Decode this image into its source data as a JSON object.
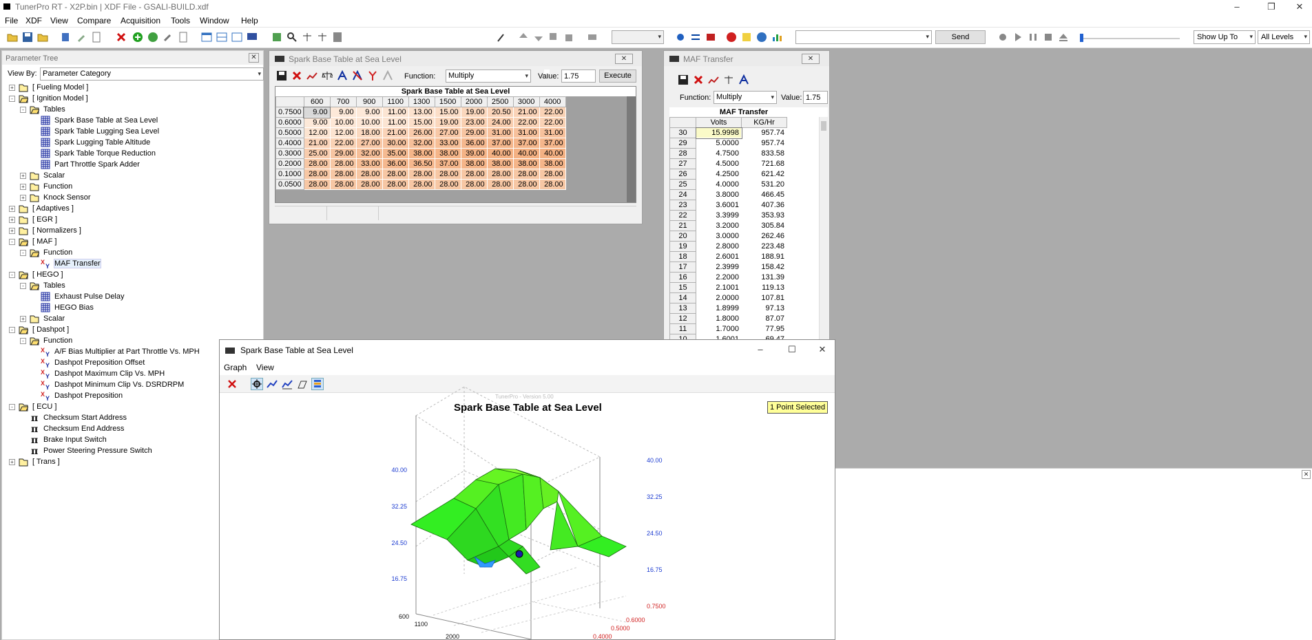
{
  "app": {
    "title": "TunerPro RT - X2P.bin | XDF File - GSALI-BUILD.xdf"
  },
  "menu": [
    "File",
    "XDF",
    "View",
    "Compare",
    "Acquisition",
    "Tools",
    "Window",
    "Help"
  ],
  "toolbar": {
    "send_label": "Send",
    "show_up_to": "Show Up To",
    "levels": "All Levels"
  },
  "tree": {
    "title": "Parameter Tree",
    "view_by_label": "View By:",
    "view_by_value": "Parameter Category",
    "nodes": [
      {
        "label": "[ Fueling Model ]",
        "level": 0,
        "icon": "folder",
        "exp": "+"
      },
      {
        "label": "[ Ignition Model ]",
        "level": 0,
        "icon": "folder-open",
        "exp": "-"
      },
      {
        "label": "Tables",
        "level": 1,
        "icon": "folder-open",
        "exp": "-"
      },
      {
        "label": "Spark Base Table at Sea Level",
        "level": 2,
        "icon": "table"
      },
      {
        "label": "Spark Table Lugging Sea Level",
        "level": 2,
        "icon": "table"
      },
      {
        "label": "Spark Lugging Table Altitude",
        "level": 2,
        "icon": "table"
      },
      {
        "label": "Spark Table Torque Reduction",
        "level": 2,
        "icon": "table"
      },
      {
        "label": "Part Throttle Spark Adder",
        "level": 2,
        "icon": "table"
      },
      {
        "label": "Scalar",
        "level": 1,
        "icon": "folder",
        "exp": "+"
      },
      {
        "label": "Function",
        "level": 1,
        "icon": "folder",
        "exp": "+"
      },
      {
        "label": "Knock Sensor",
        "level": 1,
        "icon": "folder",
        "exp": "+"
      },
      {
        "label": "[ Adaptives ]",
        "level": 0,
        "icon": "folder",
        "exp": "+"
      },
      {
        "label": "[ EGR ]",
        "level": 0,
        "icon": "folder",
        "exp": "+"
      },
      {
        "label": "[ Normalizers ]",
        "level": 0,
        "icon": "folder",
        "exp": "+"
      },
      {
        "label": "[ MAF ]",
        "level": 0,
        "icon": "folder-open",
        "exp": "-"
      },
      {
        "label": "Function",
        "level": 1,
        "icon": "folder-open",
        "exp": "-"
      },
      {
        "label": "MAF Transfer",
        "level": 2,
        "icon": "xy",
        "selected": true
      },
      {
        "label": "[ HEGO ]",
        "level": 0,
        "icon": "folder-open",
        "exp": "-"
      },
      {
        "label": "Tables",
        "level": 1,
        "icon": "folder-open",
        "exp": "-"
      },
      {
        "label": "Exhaust Pulse Delay",
        "level": 2,
        "icon": "table"
      },
      {
        "label": "HEGO Bias",
        "level": 2,
        "icon": "table"
      },
      {
        "label": "Scalar",
        "level": 1,
        "icon": "folder",
        "exp": "+"
      },
      {
        "label": "[ Dashpot ]",
        "level": 0,
        "icon": "folder-open",
        "exp": "-"
      },
      {
        "label": "Function",
        "level": 1,
        "icon": "folder-open",
        "exp": "-"
      },
      {
        "label": "A/F Bias Multiplier at Part Throttle Vs. MPH",
        "level": 2,
        "icon": "xy"
      },
      {
        "label": "Dashpot Preposition Offset",
        "level": 2,
        "icon": "xy"
      },
      {
        "label": "Dashpot Maximum Clip Vs. MPH",
        "level": 2,
        "icon": "xy"
      },
      {
        "label": "Dashpot Minimum Clip Vs. DSRDRPM",
        "level": 2,
        "icon": "xy"
      },
      {
        "label": "Dashpot Preposition",
        "level": 2,
        "icon": "xy"
      },
      {
        "label": "[ ECU ]",
        "level": 0,
        "icon": "folder-open",
        "exp": "-"
      },
      {
        "label": "Checksum Start Address",
        "level": 1,
        "icon": "pi"
      },
      {
        "label": "Checksum End Address",
        "level": 1,
        "icon": "pi"
      },
      {
        "label": "Brake Input Switch",
        "level": 1,
        "icon": "pi"
      },
      {
        "label": "Power Steering Pressure Switch",
        "level": 1,
        "icon": "pi"
      },
      {
        "label": "[ Trans ]",
        "level": 0,
        "icon": "folder",
        "exp": "+"
      }
    ]
  },
  "spark_table": {
    "window_title": "Spark Base Table at Sea Level",
    "function_label": "Function:",
    "function_value": "Multiply",
    "value_label": "Value:",
    "value": "1.75",
    "execute_label": "Execute",
    "table_title": "Spark Base Table at Sea Level",
    "cols": [
      "600",
      "700",
      "900",
      "1100",
      "1300",
      "1500",
      "2000",
      "2500",
      "3000",
      "4000"
    ],
    "rows": [
      {
        "h": "0.7500",
        "v": [
          "9.00",
          "9.00",
          "9.00",
          "11.00",
          "13.00",
          "15.00",
          "19.00",
          "20.50",
          "21.00",
          "22.00"
        ]
      },
      {
        "h": "0.6000",
        "v": [
          "9.00",
          "10.00",
          "10.00",
          "11.00",
          "15.00",
          "19.00",
          "23.00",
          "24.00",
          "22.00",
          "22.00"
        ]
      },
      {
        "h": "0.5000",
        "v": [
          "12.00",
          "12.00",
          "18.00",
          "21.00",
          "26.00",
          "27.00",
          "29.00",
          "31.00",
          "31.00",
          "31.00"
        ]
      },
      {
        "h": "0.4000",
        "v": [
          "21.00",
          "22.00",
          "27.00",
          "30.00",
          "32.00",
          "33.00",
          "36.00",
          "37.00",
          "37.00",
          "37.00"
        ]
      },
      {
        "h": "0.3000",
        "v": [
          "25.00",
          "29.00",
          "32.00",
          "35.00",
          "38.00",
          "38.00",
          "39.00",
          "40.00",
          "40.00",
          "40.00"
        ]
      },
      {
        "h": "0.2000",
        "v": [
          "28.00",
          "28.00",
          "33.00",
          "36.00",
          "36.50",
          "37.00",
          "38.00",
          "38.00",
          "38.00",
          "38.00"
        ]
      },
      {
        "h": "0.1000",
        "v": [
          "28.00",
          "28.00",
          "28.00",
          "28.00",
          "28.00",
          "28.00",
          "28.00",
          "28.00",
          "28.00",
          "28.00"
        ]
      },
      {
        "h": "0.0500",
        "v": [
          "28.00",
          "28.00",
          "28.00",
          "28.00",
          "28.00",
          "28.00",
          "28.00",
          "28.00",
          "28.00",
          "28.00"
        ]
      }
    ]
  },
  "maf": {
    "window_title": "MAF Transfer",
    "function_label": "Function:",
    "function_value": "Multiply",
    "value_label": "Value:",
    "value": "1.75",
    "table_title": "MAF Transfer",
    "col_volts": "Volts",
    "col_kg": "KG/Hr",
    "rows": [
      {
        "i": "30",
        "v": "15.9998",
        "k": "957.74"
      },
      {
        "i": "29",
        "v": "5.0000",
        "k": "957.74"
      },
      {
        "i": "28",
        "v": "4.7500",
        "k": "833.58"
      },
      {
        "i": "27",
        "v": "4.5000",
        "k": "721.68"
      },
      {
        "i": "26",
        "v": "4.2500",
        "k": "621.42"
      },
      {
        "i": "25",
        "v": "4.0000",
        "k": "531.20"
      },
      {
        "i": "24",
        "v": "3.8000",
        "k": "466.45"
      },
      {
        "i": "23",
        "v": "3.6001",
        "k": "407.36"
      },
      {
        "i": "22",
        "v": "3.3999",
        "k": "353.93"
      },
      {
        "i": "21",
        "v": "3.2000",
        "k": "305.84"
      },
      {
        "i": "20",
        "v": "3.0000",
        "k": "262.46"
      },
      {
        "i": "19",
        "v": "2.8000",
        "k": "223.48"
      },
      {
        "i": "18",
        "v": "2.6001",
        "k": "188.91"
      },
      {
        "i": "17",
        "v": "2.3999",
        "k": "158.42"
      },
      {
        "i": "16",
        "v": "2.2000",
        "k": "131.39"
      },
      {
        "i": "15",
        "v": "2.1001",
        "k": "119.13"
      },
      {
        "i": "14",
        "v": "2.0000",
        "k": "107.81"
      },
      {
        "i": "13",
        "v": "1.8999",
        "k": "97.13"
      },
      {
        "i": "12",
        "v": "1.8000",
        "k": "87.07"
      },
      {
        "i": "11",
        "v": "1.7000",
        "k": "77.95"
      },
      {
        "i": "10",
        "v": "1.6001",
        "k": "69.47"
      }
    ]
  },
  "graph": {
    "window_title": "Spark Base Table at Sea Level",
    "menu": [
      "Graph",
      "View"
    ],
    "watermark": "TunerPro - Version 5.00",
    "chart_title": "Spark Base Table at Sea Level",
    "selected_badge": "1 Point Selected",
    "z_ticks_left": [
      "40.00",
      "32.25",
      "24.50",
      "16.75"
    ],
    "z_ticks_right": [
      "40.00",
      "32.25",
      "24.50",
      "16.75"
    ],
    "x_ticks": [
      "600",
      "1100",
      "2000"
    ],
    "y_ticks": [
      "0.7500",
      "0.6000",
      "0.5000",
      "0.4000"
    ]
  },
  "colors": {
    "surface_green": "#33ee22",
    "surface_light": "#99ff33",
    "surface_blue": "#3399ff",
    "point": "#1a1aaa",
    "badge": "#ffff99",
    "table_high": "#f4b183",
    "table_low": "#fde9d9"
  }
}
